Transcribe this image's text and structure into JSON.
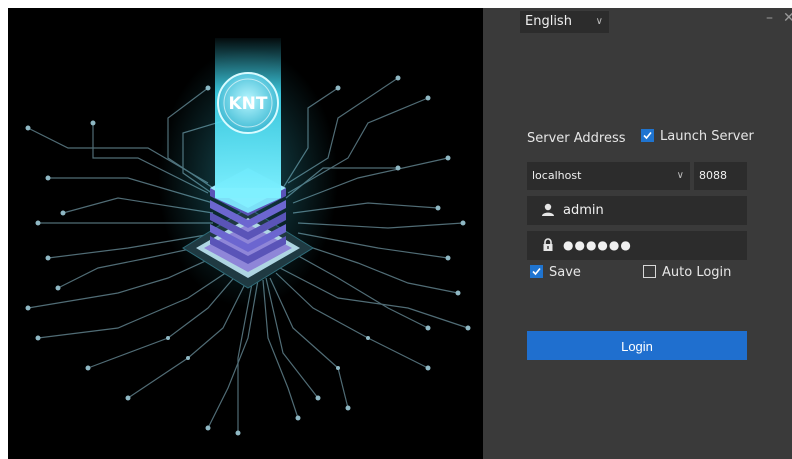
{
  "window": {
    "minimize_glyph": "–",
    "close_glyph": "✕"
  },
  "brand": {
    "logo_text": "KNT"
  },
  "language": {
    "selected": "English"
  },
  "server": {
    "label": "Server Address",
    "launch_label": "Launch Server",
    "launch_checked": true,
    "host": "localhost",
    "port": "8088"
  },
  "credentials": {
    "username": "admin",
    "password_mask": "●●●●●●"
  },
  "options": {
    "save_label": "Save",
    "save_checked": true,
    "auto_login_label": "Auto Login",
    "auto_login_checked": false
  },
  "login_button": {
    "label": "Login"
  },
  "colors": {
    "accent": "#1f6fcf",
    "panel_bg": "#3a3a3a",
    "field_bg": "#2c2c2c",
    "glow": "#3fd8f0"
  }
}
